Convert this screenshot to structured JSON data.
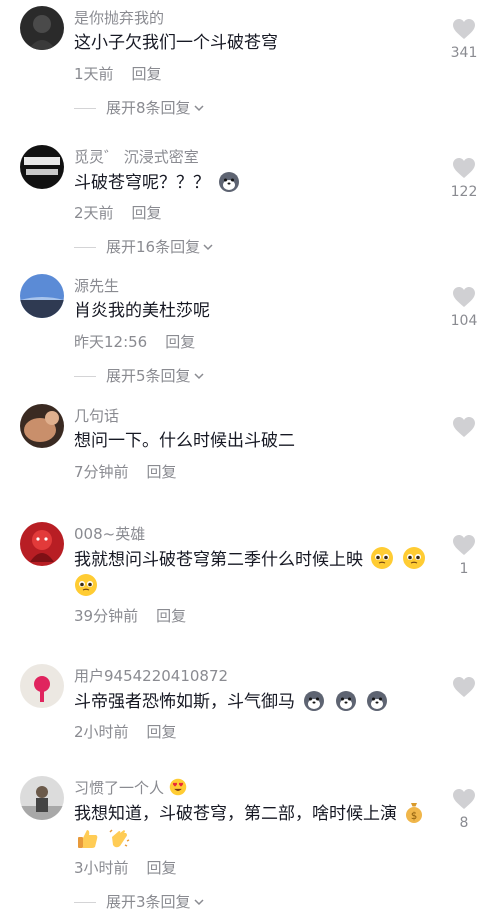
{
  "comments": [
    {
      "username": "是你抛弃我的",
      "text": "这小子欠我们一个斗破苍穹",
      "time": "1天前",
      "reply": "回复",
      "expand": "展开8条回复",
      "likes": "341"
    },
    {
      "username": "觅灵゛ 沉浸式密室",
      "text": "斗破苍穹呢？？？",
      "time": "2天前",
      "reply": "回复",
      "expand": "展开16条回复",
      "likes": "122"
    },
    {
      "username": "源先生",
      "text": "肖炎我的美杜莎呢",
      "time": "昨天12:56",
      "reply": "回复",
      "expand": "展开5条回复",
      "likes": "104"
    },
    {
      "username": "几句话",
      "text": "想问一下。什么时候出斗破二",
      "time": "7分钟前",
      "reply": "回复",
      "likes": ""
    },
    {
      "username": "008~英雄",
      "text": "我就想问斗破苍穹第二季什么时候上映",
      "time": "39分钟前",
      "reply": "回复",
      "likes": "1"
    },
    {
      "username": "用户9454220410872",
      "text": "斗帝强者恐怖如斯，斗气御马",
      "time": "2小时前",
      "reply": "回复",
      "likes": ""
    },
    {
      "username": "习惯了一个人",
      "text": "我想知道，斗破苍穹，第二部，啥时候上演",
      "time": "3小时前",
      "reply": "回复",
      "expand": "展开3条回复",
      "likes": "8"
    }
  ],
  "icons": {
    "like": "heart-outline-icon",
    "expand_arrow": "chevron-down-icon",
    "emojis": [
      "husky-emoji",
      "pleading-face-emoji",
      "heart-eyes-emoji",
      "money-bag-emoji",
      "thumbs-up-emoji",
      "clapping-hands-emoji"
    ]
  },
  "colors": {
    "text_primary": "#161823",
    "text_secondary": "#8a8b91",
    "heart": "#d0d0d3",
    "background": "#ffffff"
  }
}
